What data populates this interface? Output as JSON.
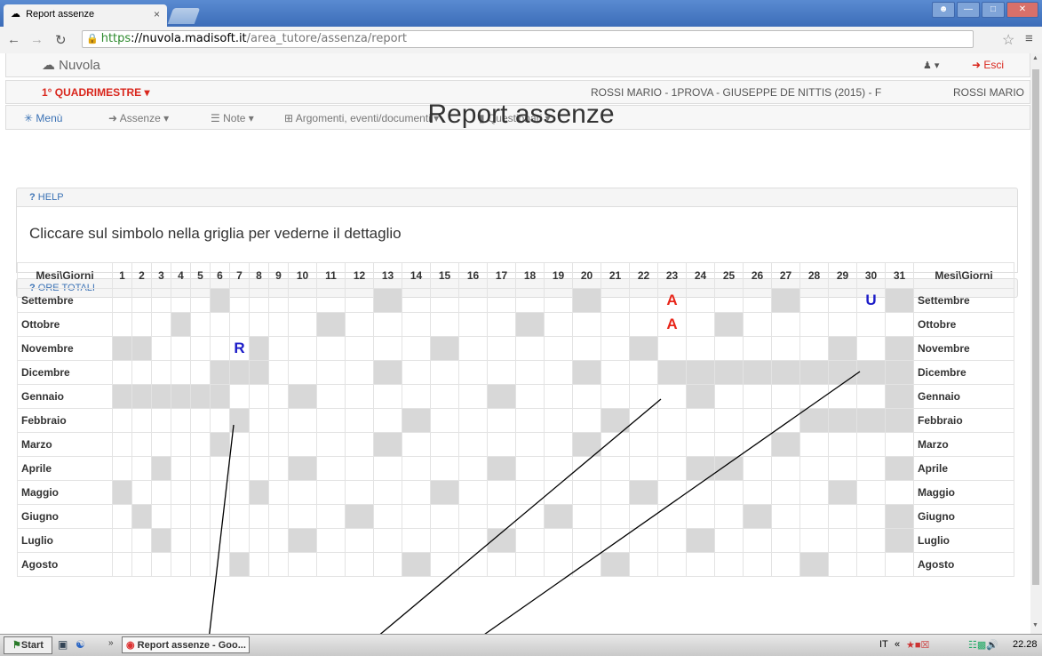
{
  "browser": {
    "tab_title": "Report assenze",
    "tab_close": "×",
    "url_https": "https",
    "url_host": "://nuvola.madisoft.it",
    "url_path": "/area_tutore/assenza/report"
  },
  "header": {
    "brand": "Nuvola",
    "esci": "Esci",
    "period": "1° QUADRIMESTRE",
    "student": "ROSSI MARIO - 1PROVA - GIUSEPPE DE NITTIS (2015) - F",
    "user": "ROSSI MARIO"
  },
  "menu": {
    "items": [
      "Menù",
      "Assenze",
      "Note",
      "Argomenti, eventi/documenti",
      "Questionari"
    ]
  },
  "page_title": "Report assenze",
  "help": {
    "heading": "HELP",
    "text": "Cliccare sul simbolo nella griglia per vederne il dettaglio"
  },
  "ore_totali": {
    "heading": "ORE TOTALI"
  },
  "grid": {
    "corner": "Mesi\\Giorni",
    "days": [
      "1",
      "2",
      "3",
      "4",
      "5",
      "6",
      "7",
      "8",
      "9",
      "10",
      "11",
      "12",
      "13",
      "14",
      "15",
      "16",
      "17",
      "18",
      "19",
      "20",
      "21",
      "22",
      "23",
      "24",
      "25",
      "26",
      "27",
      "28",
      "29",
      "30",
      "31"
    ],
    "months": [
      {
        "name": "Settembre",
        "gray": [
          6,
          13,
          20,
          27,
          31
        ],
        "symbols": {
          "23": "A",
          "30": "U"
        }
      },
      {
        "name": "Ottobre",
        "gray": [
          4,
          11,
          18,
          25
        ],
        "symbols": {
          "23": "A"
        }
      },
      {
        "name": "Novembre",
        "gray": [
          1,
          2,
          8,
          15,
          22,
          29,
          31
        ],
        "symbols": {
          "7": "R"
        }
      },
      {
        "name": "Dicembre",
        "gray": [
          6,
          7,
          8,
          13,
          20,
          23,
          24,
          25,
          26,
          27,
          28,
          29,
          30,
          31
        ],
        "symbols": {}
      },
      {
        "name": "Gennaio",
        "gray": [
          1,
          2,
          3,
          4,
          5,
          6,
          10,
          17,
          24,
          31
        ],
        "symbols": {}
      },
      {
        "name": "Febbraio",
        "gray": [
          7,
          14,
          21,
          28,
          29,
          30,
          31
        ],
        "symbols": {}
      },
      {
        "name": "Marzo",
        "gray": [
          6,
          13,
          20,
          27
        ],
        "symbols": {}
      },
      {
        "name": "Aprile",
        "gray": [
          3,
          10,
          17,
          24,
          25,
          31
        ],
        "symbols": {}
      },
      {
        "name": "Maggio",
        "gray": [
          1,
          8,
          15,
          22,
          29
        ],
        "symbols": {}
      },
      {
        "name": "Giugno",
        "gray": [
          2,
          12,
          19,
          26,
          31
        ],
        "symbols": {}
      },
      {
        "name": "Luglio",
        "gray": [
          3,
          10,
          17,
          24,
          31
        ],
        "symbols": {}
      },
      {
        "name": "Agosto",
        "gray": [
          7,
          14,
          21,
          28
        ],
        "symbols": {}
      }
    ],
    "symbol_colors": {
      "A": "#e8261a",
      "U": "#1c1cc8",
      "R": "#1c1cc8"
    }
  },
  "taskbar": {
    "start": "Start",
    "task": "Report assenze - Goo...",
    "lang": "IT",
    "clock": "22.28"
  },
  "colors": {
    "accent_red": "#d9261c",
    "link_blue": "#3b72b5",
    "weekend_gray": "#d8d8d8"
  }
}
